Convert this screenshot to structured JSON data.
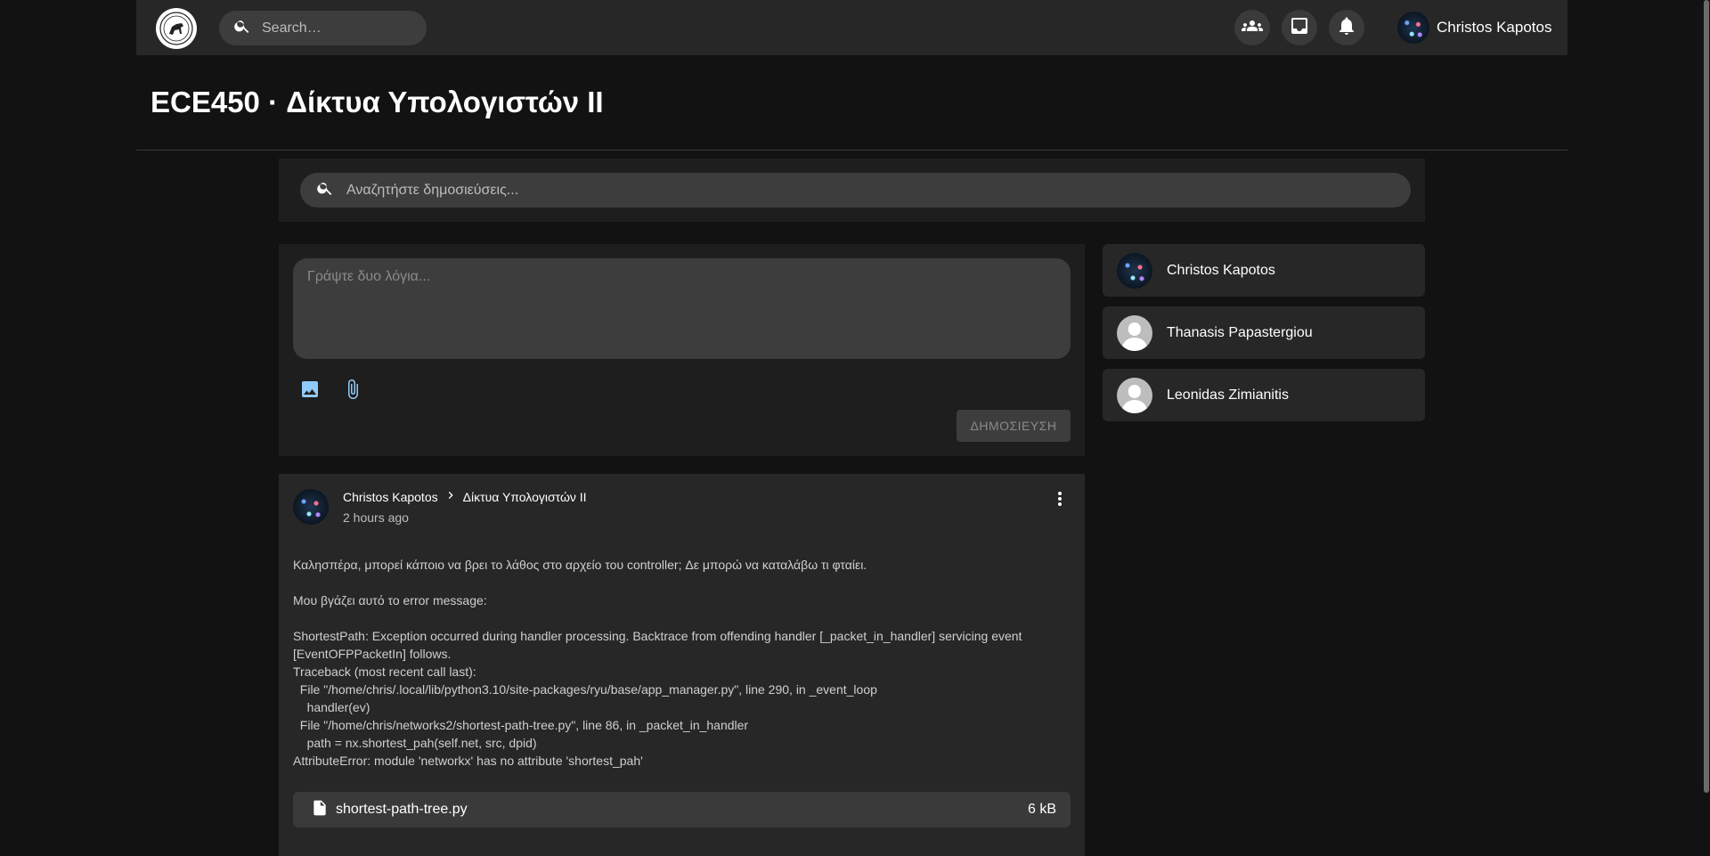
{
  "appbar": {
    "search_placeholder": "Search…",
    "user_name": "Christos Kapotos"
  },
  "course": {
    "title": "ECE450 · Δίκτυα Υπολογιστών II"
  },
  "post_search": {
    "placeholder": "Αναζητήστε δημοσιεύσεις..."
  },
  "composer": {
    "placeholder": "Γράψτε δυο λόγια...",
    "publish_label": "ΔΗΜΟΣΙΕΥΣΗ"
  },
  "members": [
    {
      "name": "Christos Kapotos",
      "avatar": "network-avatar"
    },
    {
      "name": "Thanasis Papastergiou",
      "avatar": "default-avatar"
    },
    {
      "name": "Leonidas Zimianitis",
      "avatar": "default-avatar"
    }
  ],
  "post": {
    "author": "Christos Kapotos",
    "course": "Δίκτυα Υπολογιστών II",
    "time": "2 hours ago",
    "body": "Καλησπέρα, μπορεί κάποιο να βρει το λάθος στο αρχείο του controller; Δε μπορώ να καταλάβω τι φταίει.\n\nΜου βγάζει αυτό το error message:\n\nShortestPath: Exception occurred during handler processing. Backtrace from offending handler [_packet_in_handler] servicing event [EventOFPPacketIn] follows.\nTraceback (most recent call last):\n  File \"/home/chris/.local/lib/python3.10/site-packages/ryu/base/app_manager.py\", line 290, in _event_loop\n    handler(ev)\n  File \"/home/chris/networks2/shortest-path-tree.py\", line 86, in _packet_in_handler\n    path = nx.shortest_pah(self.net, src, dpid)\nAttributeError: module 'networkx' has no attribute 'shortest_pah'",
    "attachment": {
      "name": "shortest-path-tree.py",
      "size": "6 kB"
    }
  },
  "colors": {
    "background": "#121212",
    "surface": "#1e1e1e",
    "card": "#272727",
    "input": "#3d3d3d",
    "accent_icon": "#90caf9"
  },
  "icons": [
    "university-logo",
    "search-icon",
    "groups-icon",
    "inbox-icon",
    "bell-icon",
    "image-icon",
    "paperclip-icon",
    "chevron-right-icon",
    "more-vert-icon",
    "file-icon"
  ]
}
